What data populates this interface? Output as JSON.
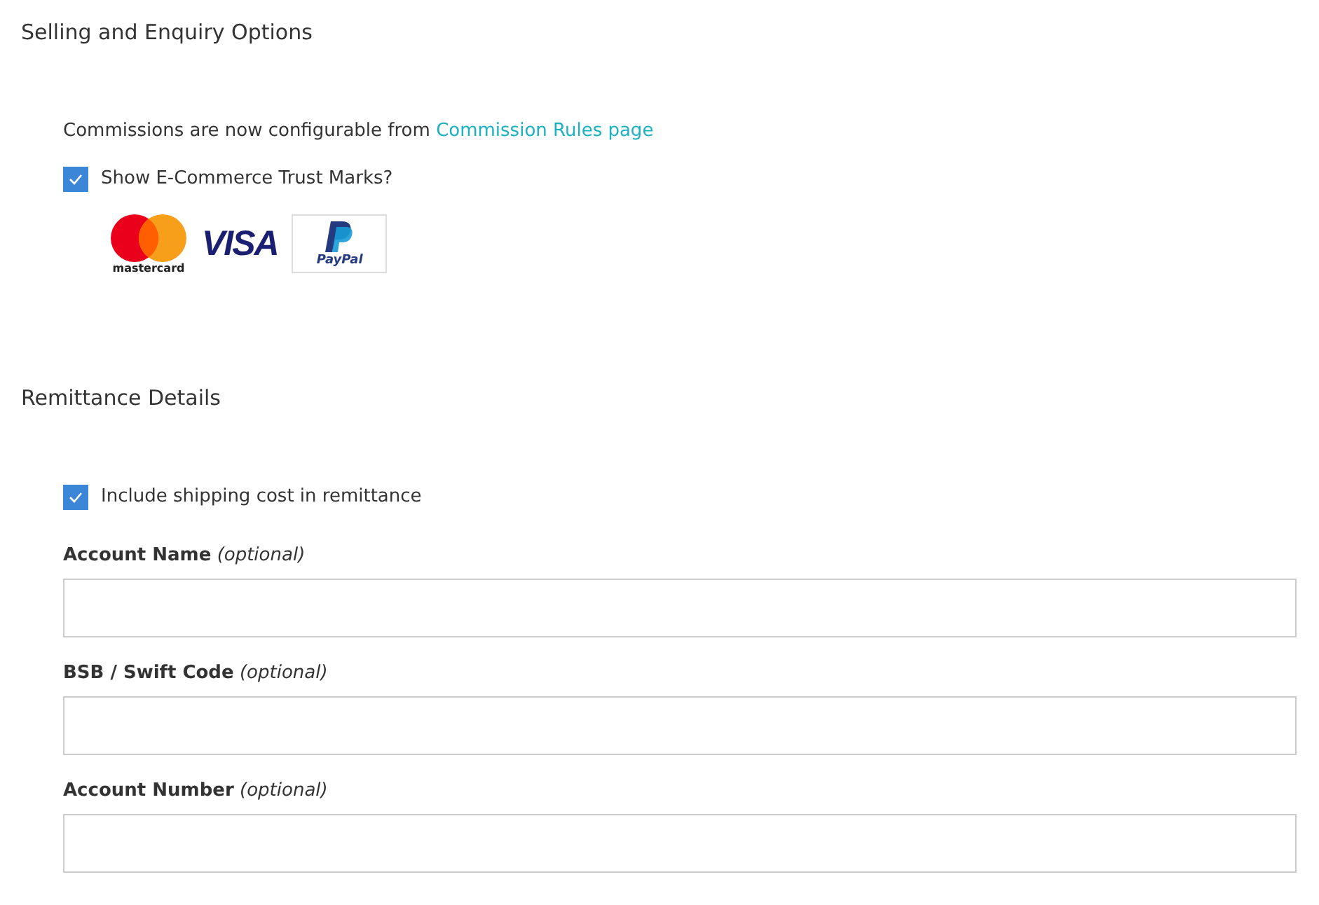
{
  "sections": [
    {
      "title": "Selling and Enquiry Options",
      "notice": {
        "text": "Commissions are now configurable from",
        "link": "Commission Rules page"
      },
      "checkbox": {
        "label": "Show E-Commerce Trust Marks?",
        "checked": true
      },
      "trust_marks": [
        {
          "kind": "mastercard",
          "label": "mastercard"
        },
        {
          "kind": "visa",
          "label": "VISA"
        },
        {
          "kind": "paypal",
          "label": "PayPal"
        }
      ]
    },
    {
      "title": "Remittance Details",
      "checkbox": {
        "label": "Include shipping cost in remittance",
        "checked": true
      },
      "fields": [
        {
          "label": "**Account Name** *(optional)*"
        },
        {
          "label": "**BSB / Swift Code** *(optional)*"
        },
        {
          "label": "**Account Number** *(optional)*"
        }
      ]
    }
  ]
}
